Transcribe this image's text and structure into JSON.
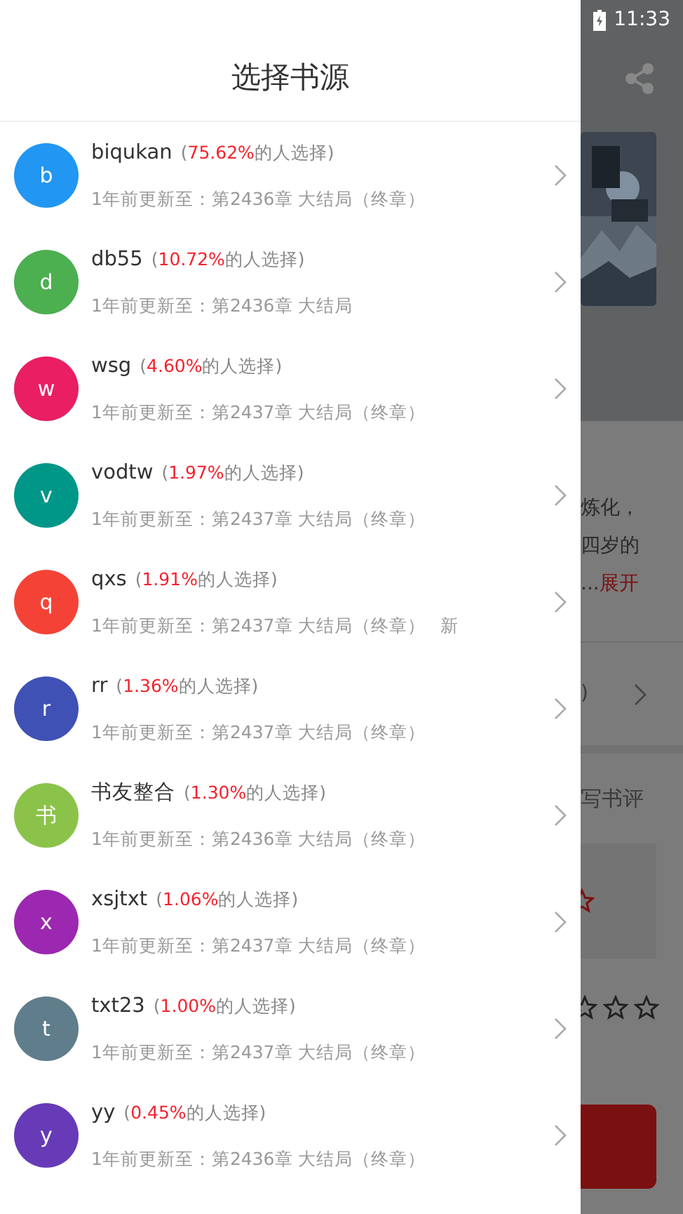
{
  "status_bar": {
    "time": "11:33"
  },
  "drawer": {
    "title": "选择书源",
    "sources": [
      {
        "avatar": "b",
        "color": "#2196f3",
        "name": "biqukan",
        "share": {
          "open": "(",
          "percent": "75.62%",
          "rest": "的人选择)"
        },
        "update": "1年前更新至：第2436章 大结局（终章）"
      },
      {
        "avatar": "d",
        "color": "#4caf50",
        "name": "db55",
        "share": {
          "open": "(",
          "percent": "10.72%",
          "rest": "的人选择)"
        },
        "update": "1年前更新至：第2436章 大结局"
      },
      {
        "avatar": "w",
        "color": "#e91e63",
        "name": "wsg",
        "share": {
          "open": "(",
          "percent": "4.60%",
          "rest": "的人选择)"
        },
        "update": "1年前更新至：第2437章 大结局（终章）"
      },
      {
        "avatar": "v",
        "color": "#009688",
        "name": "vodtw",
        "share": {
          "open": "(",
          "percent": "1.97%",
          "rest": "的人选择)"
        },
        "update": "1年前更新至：第2437章 大结局（终章）"
      },
      {
        "avatar": "q",
        "color": "#f44336",
        "name": "qxs",
        "share": {
          "open": "(",
          "percent": "1.91%",
          "rest": "的人选择)"
        },
        "update": "1年前更新至：第2437章 大结局（终章）",
        "tag": "新"
      },
      {
        "avatar": "r",
        "color": "#3f51b5",
        "name": "rr",
        "share": {
          "open": "(",
          "percent": "1.36%",
          "rest": "的人选择)"
        },
        "update": "1年前更新至：第2437章 大结局（终章）"
      },
      {
        "avatar": "书",
        "color": "#8bc34a",
        "name": "书友整合",
        "share": {
          "open": "(",
          "percent": "1.30%",
          "rest": "的人选择)"
        },
        "update": "1年前更新至：第2436章 大结局（终章）"
      },
      {
        "avatar": "x",
        "color": "#9c27b0",
        "name": "xsjtxt",
        "share": {
          "open": "(",
          "percent": "1.06%",
          "rest": "的人选择)"
        },
        "update": "1年前更新至：第2437章 大结局（终章）"
      },
      {
        "avatar": "t",
        "color": "#607d8b",
        "name": "txt23",
        "share": {
          "open": "(",
          "percent": "1.00%",
          "rest": "的人选择)"
        },
        "update": "1年前更新至：第2437章 大结局（终章）"
      },
      {
        "avatar": "y",
        "color": "#673ab7",
        "name": "yy",
        "share": {
          "open": "(",
          "percent": "0.45%",
          "rest": "的人选择)"
        },
        "update": "1年前更新至：第2436章 大结局（终章）"
      }
    ]
  },
  "background": {
    "description_lines": [
      "炼化，",
      "四岁的"
    ],
    "ellipsis": "...",
    "expand_link": "展开",
    "row_fragment": ")",
    "review_link": "写书评"
  }
}
